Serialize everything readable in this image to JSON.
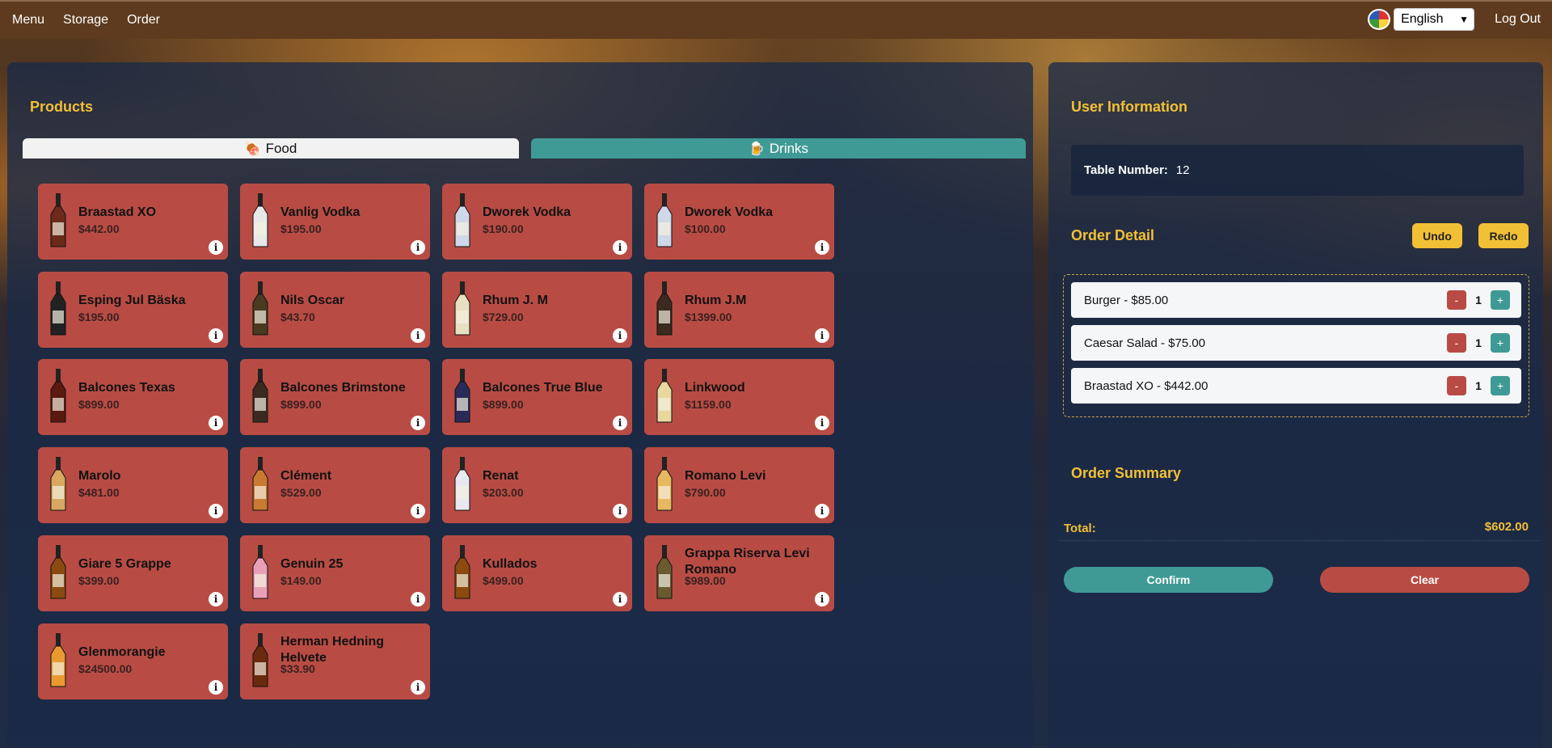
{
  "nav": {
    "items": [
      {
        "label": "Menu"
      },
      {
        "label": "Storage"
      },
      {
        "label": "Order"
      }
    ],
    "language": "English",
    "logout": "Log Out",
    "flag_icon": "language-flag-icon"
  },
  "products": {
    "title": "Products",
    "tabs": [
      {
        "label": "Food",
        "icon": "meat-icon",
        "active": false
      },
      {
        "label": "Drinks",
        "icon": "beer-icon",
        "active": true
      }
    ],
    "items": [
      {
        "name": "Braastad XO",
        "price": "$442.00"
      },
      {
        "name": "Vanlig Vodka",
        "price": "$195.00"
      },
      {
        "name": "Dworek Vodka",
        "price": "$190.00"
      },
      {
        "name": "Dworek Vodka",
        "price": "$100.00"
      },
      {
        "name": "Esping Jul Bäska",
        "price": "$195.00"
      },
      {
        "name": "Nils Oscar",
        "price": "$43.70"
      },
      {
        "name": "Rhum J. M",
        "price": "$729.00"
      },
      {
        "name": "Rhum J.M",
        "price": "$1399.00"
      },
      {
        "name": "Balcones Texas",
        "price": "$899.00"
      },
      {
        "name": "Balcones Brimstone",
        "price": "$899.00"
      },
      {
        "name": "Balcones True Blue",
        "price": "$899.00"
      },
      {
        "name": "Linkwood",
        "price": "$1159.00"
      },
      {
        "name": "Marolo",
        "price": "$481.00"
      },
      {
        "name": "Clément",
        "price": "$529.00"
      },
      {
        "name": "Renat",
        "price": "$203.00"
      },
      {
        "name": "Romano Levi",
        "price": "$790.00"
      },
      {
        "name": "Giare 5 Grappe",
        "price": "$399.00"
      },
      {
        "name": "Genuin 25",
        "price": "$149.00"
      },
      {
        "name": "Kullados",
        "price": "$499.00"
      },
      {
        "name": "Grappa Riserva Levi Romano",
        "price": "$989.00"
      },
      {
        "name": "Glenmorangie",
        "price": "$24500.00"
      },
      {
        "name": "Herman Hedning Helvete",
        "price": "$33.90"
      }
    ]
  },
  "user": {
    "title": "User Information",
    "table_label": "Table Number:",
    "table_value": "12"
  },
  "order": {
    "title": "Order Detail",
    "undo": "Undo",
    "redo": "Redo",
    "items": [
      {
        "label": "Burger - $85.00",
        "qty": "1"
      },
      {
        "label": "Caesar Salad - $75.00",
        "qty": "1"
      },
      {
        "label": "Braastad XO - $442.00",
        "qty": "1"
      }
    ]
  },
  "summary": {
    "title": "Order Summary",
    "total_label": "Total:",
    "total_value": "$602.00",
    "confirm": "Confirm",
    "clear": "Clear"
  },
  "colors": {
    "accent_yellow": "#f2c035",
    "card_red": "#b84c44",
    "teal": "#3f9a95",
    "topbar_brown": "#5e3b1e"
  }
}
